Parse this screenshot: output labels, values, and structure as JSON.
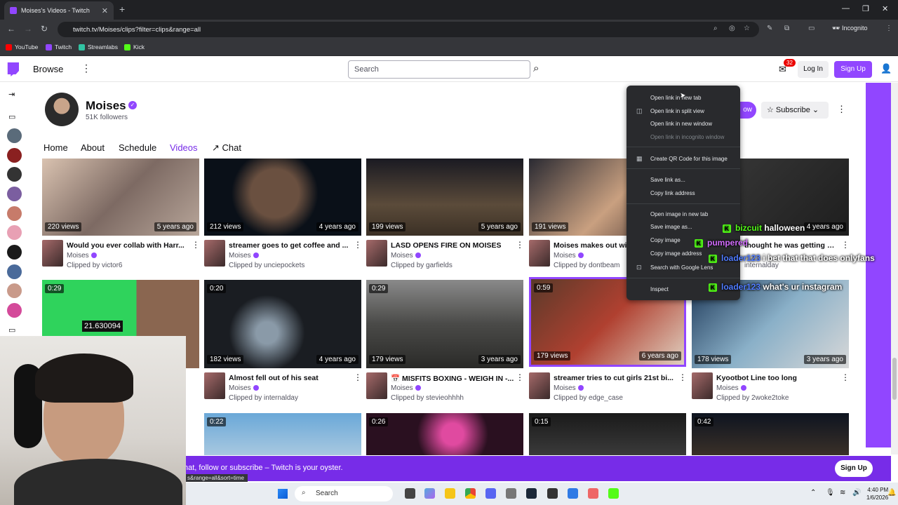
{
  "browser": {
    "tab_title": "Moises's Videos - Twitch",
    "tab_close": "✕",
    "new_tab": "+",
    "url": "twitch.tv/Moises/clips?filter=clips&range=all",
    "incognito": "Incognito",
    "bookmarks": [
      {
        "label": "YouTube",
        "color": "#ff0000"
      },
      {
        "label": "Twitch",
        "color": "#9146ff"
      },
      {
        "label": "Streamlabs",
        "color": "#31c3a2"
      },
      {
        "label": "Kick",
        "color": "#53fc18"
      }
    ]
  },
  "twitch_nav": {
    "browse": "Browse",
    "search_placeholder": "Search",
    "notification_count": "32",
    "login": "Log In",
    "signup": "Sign Up"
  },
  "channel": {
    "name": "Moises",
    "followers": "51K followers",
    "follow_label": "ow",
    "subscribe_label": "Subscribe",
    "tabs": [
      "Home",
      "About",
      "Schedule",
      "Videos",
      "Chat"
    ],
    "active_tab": "Videos"
  },
  "clips": [
    {
      "duration": "",
      "views": "220 views",
      "ago": "5 years ago",
      "title": "Would you ever collab with Harr...",
      "channel": "Moises",
      "clipped_by": "Clipped by victor6"
    },
    {
      "duration": "",
      "views": "212 views",
      "ago": "4 years ago",
      "title": "streamer goes to get coffee and ...",
      "channel": "Moises",
      "clipped_by": "Clipped by unciepockets"
    },
    {
      "duration": "",
      "views": "199 views",
      "ago": "5 years ago",
      "title": "LASD OPENS FIRE ON MOISES",
      "channel": "Moises",
      "clipped_by": "Clipped by garfields"
    },
    {
      "duration": "",
      "views": "191 views",
      "ago": "",
      "title": "Moises makes out wi",
      "channel": "Moises",
      "clipped_by": "Clipped by dontbeam"
    },
    {
      "duration": "",
      "views": "",
      "ago": "4 years ago",
      "title": "thought he was getting r...",
      "channel": "",
      "clipped_by": "internalday"
    },
    {
      "duration": "0:29",
      "views": "",
      "ago": "",
      "title": "",
      "channel": "",
      "clipped_by": ""
    },
    {
      "duration": "0:20",
      "views": "182 views",
      "ago": "4 years ago",
      "title": "Almost fell out of his seat",
      "channel": "Moises",
      "clipped_by": "Clipped by internalday"
    },
    {
      "duration": "0:29",
      "views": "179 views",
      "ago": "3 years ago",
      "title": "MISFITS BOXING - WEIGH IN -...",
      "channel": "Moises",
      "clipped_by": "Clipped by stevieohhhh"
    },
    {
      "duration": "0:59",
      "views": "179 views",
      "ago": "6 years ago",
      "title": "streamer tries to cut girls 21st bi...",
      "channel": "Moises",
      "clipped_by": "Clipped by edge_case"
    },
    {
      "duration": "",
      "views": "178 views",
      "ago": "3 years ago",
      "title": "Kyootbot Line too long",
      "channel": "Moises",
      "clipped_by": "Clipped by 2woke2toke"
    },
    {
      "duration": "0:22",
      "views": "",
      "ago": "",
      "title": "",
      "channel": "",
      "clipped_by": ""
    },
    {
      "duration": "0:26",
      "views": "",
      "ago": "",
      "title": "",
      "channel": "",
      "clipped_by": ""
    },
    {
      "duration": "0:15",
      "views": "",
      "ago": "",
      "title": "",
      "channel": "",
      "clipped_by": ""
    },
    {
      "duration": "0:42",
      "views": "",
      "ago": "",
      "title": "",
      "channel": "",
      "clipped_by": ""
    }
  ],
  "context_menu": {
    "items": [
      "Open link in new tab",
      "Open link in split view",
      "Open link in new window",
      "Open link in incognito window",
      "Create QR Code for this image",
      "Save link as...",
      "Copy link address",
      "Open image in new tab",
      "Save image as...",
      "Copy image",
      "Copy image address",
      "Search with Google Lens",
      "Inspect"
    ]
  },
  "chat_overlay": [
    {
      "user": "bizcuit",
      "message": "halloween",
      "user_color": "#53fc18"
    },
    {
      "user": "pumpered",
      "message": "",
      "user_color": "#d36cff"
    },
    {
      "user": "loader123",
      "message": "i bet that that does onlyfans",
      "user_color": "#4f7bff"
    },
    {
      "user": "loader123",
      "message": "what's ur instagram",
      "user_color": "#4f7bff"
    }
  ],
  "banner": {
    "text": "hat, follow or subscribe – Twitch is your oyster.",
    "signup": "Sign Up",
    "status_url": "s&range=all&sort=time"
  },
  "taskbar": {
    "search": "Search",
    "time": "4:40 PM",
    "date": "1/6/2026"
  },
  "overlay_text": {
    "phone_number": "21.630094"
  }
}
